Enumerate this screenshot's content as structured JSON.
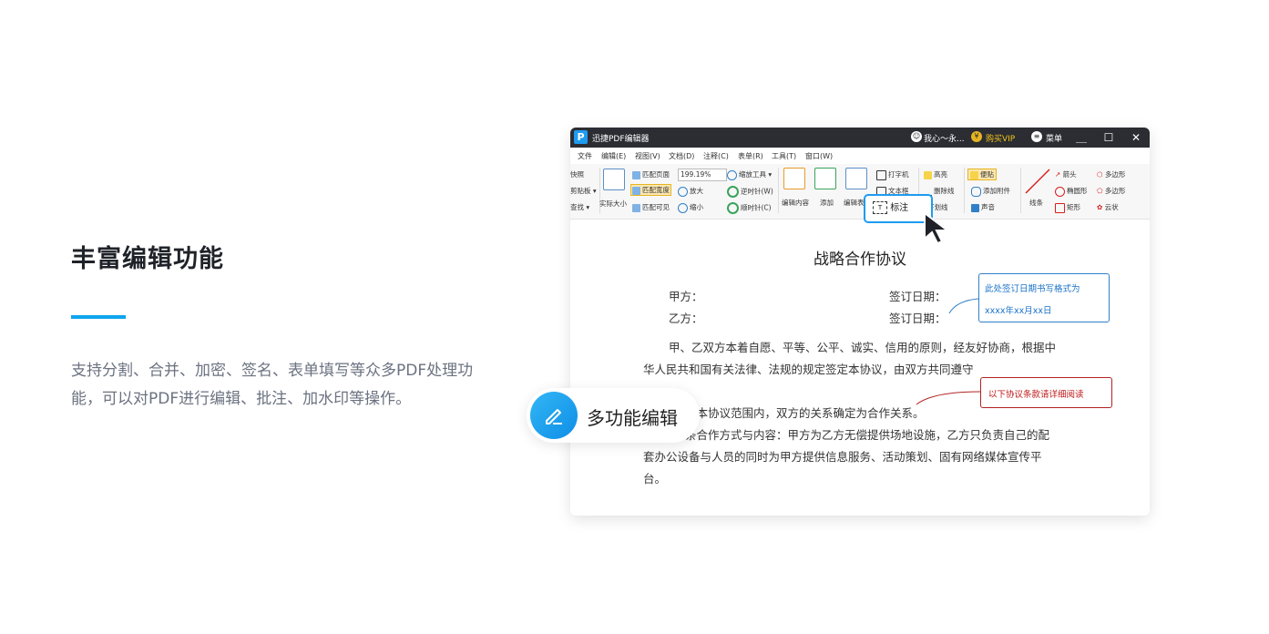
{
  "feature": {
    "heading": "丰富编辑功能",
    "description": "支持分割、合并、加密、签名、表单填写等众多PDF处理功能，可以对PDF进行编辑、批注、加水印等操作。",
    "accent_color": "#0ea5ee"
  },
  "window": {
    "app_title": "迅捷PDF编辑器",
    "user_label": "我心～永...",
    "vip_label": "购买VIP",
    "menu_label": "菜单",
    "minimize": "＿",
    "maximize": "☐",
    "close": "✕",
    "menus": [
      "文件",
      "编辑(E)",
      "视图(V)",
      "文档(D)",
      "注释(C)",
      "表单(R)",
      "工具(T)",
      "窗口(W)"
    ]
  },
  "ribbon": {
    "left_clip": [
      "快照",
      "剪贴板 ▾",
      "查找 ▾"
    ],
    "actual_size": "实际大小",
    "fit_page": "匹配页面",
    "fit_width": "匹配宽度",
    "fit_visible": "匹配可见",
    "zoom_value": "199.19%",
    "zoom_tool": "缩放工具",
    "zoom_in": "放大",
    "zoom_out": "缩小",
    "rotate_ccw": "逆时针(W)",
    "rotate_cw": "顺时针(C)",
    "edit_content": "编辑内容",
    "add": "添加",
    "edit_form": "编辑表",
    "typewriter": "打字机",
    "textbox": "文本框",
    "callout": "标注",
    "highlight": "高亮",
    "strikeout": "删除线",
    "underline": "下划线",
    "sticky": "便贴",
    "attach": "添加附件",
    "sound": "声音",
    "line": "线条",
    "arrow": "箭头",
    "ellipse": "椭圆形",
    "rect": "矩形",
    "polygon": "多边形",
    "polyline": "多边形",
    "cloud": "云状"
  },
  "document": {
    "title": "战略合作协议",
    "party_a": "甲方：",
    "party_b": "乙方：",
    "sign_date_1": "签订日期：",
    "sign_date_2": "签订日期：",
    "para1_line1": "甲、乙双方本着自愿、平等、公平、诚实、信用的原则，经友好协商，根据中",
    "para1_line2": "华人民共和国有关法律、法规的规定签定本协议，由双方共同遵守",
    "para2_line1": "在本协议范围内，双方的关系确定为合作关系。",
    "para3_line1": "条合作方式与内容：甲方为乙方无偿提供场地设施，乙方只负责自己的配",
    "para3_line2": "套办公设备与人员的同时为甲方提供信息服务、活动策划、固有网络媒体宣传平",
    "para3_line3": "台。",
    "note_blue_line1": "此处签订日期书写格式为",
    "note_blue_line2": "xxxx年xx月xx日",
    "note_red": "以下协议条款请详细阅读"
  },
  "badge": {
    "label": "多功能编辑",
    "icon": "pencil-icon"
  }
}
